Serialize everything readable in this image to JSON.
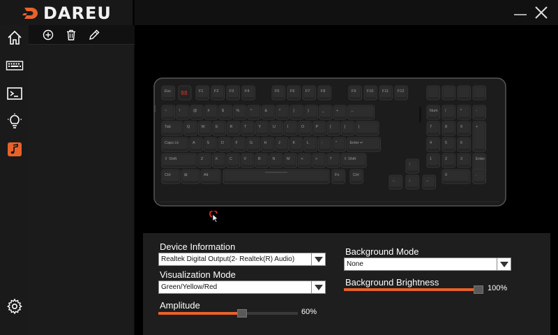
{
  "app": {
    "logo_text": "DAREU",
    "accent": "#e8622a"
  },
  "window": {
    "controls": [
      "minimize-icon",
      "close-icon"
    ]
  },
  "nav": {
    "items": [
      "home-icon",
      "keyboard-icon",
      "terminal-icon",
      "lightbulb-icon",
      "music-icon"
    ],
    "active": "music-icon",
    "bottom": "gear-icon"
  },
  "profile_toolbar": {
    "tools": [
      "add-icon",
      "trash-icon",
      "pencil-icon"
    ]
  },
  "keyboard": {
    "display": "98",
    "row0": [
      "Esc",
      "",
      "F1",
      "F2",
      "F3",
      "F4",
      "F5",
      "F6",
      "F7",
      "F8",
      "F9",
      "F10",
      "F11",
      "F12",
      "",
      "",
      "",
      ""
    ],
    "row1": [
      "~",
      "!",
      "@",
      "#",
      "$",
      "%",
      "^",
      "&",
      "*",
      "(",
      ")",
      "_",
      "+",
      "←",
      "Num",
      "/",
      "*",
      "-"
    ],
    "row2": [
      "Tab",
      "Q",
      "W",
      "E",
      "R",
      "T",
      "Y",
      "U",
      "I",
      "O",
      "P",
      "{",
      "}",
      "|",
      "7",
      "8",
      "9",
      "+"
    ],
    "row3": [
      "Caps Lk",
      "A",
      "S",
      "D",
      "F",
      "G",
      "H",
      "J",
      "K",
      "L",
      ":",
      "\"",
      "Enter ↵",
      "4",
      "5",
      "6"
    ],
    "row4": [
      "⇧ Shift",
      "Z",
      "X",
      "C",
      "V",
      "B",
      "N",
      "M",
      "<",
      ">",
      "?",
      "⇧ Shift",
      "↑",
      "1",
      "2",
      "3",
      "Enter"
    ],
    "row5": [
      "Ctrl",
      "⊞",
      "Alt",
      "",
      "Fn",
      "Ctrl",
      "←",
      "↓",
      "→",
      "0",
      "."
    ]
  },
  "settings": {
    "device_info": {
      "label": "Device Information",
      "value": "Realtek Digital Output(2- Realtek(R) Audio)"
    },
    "visualization_mode": {
      "label": "Visualization Mode",
      "value": "Green/Yellow/Red"
    },
    "amplitude": {
      "label": "Amplitude",
      "value": 60,
      "display": "60%"
    },
    "background_mode": {
      "label": "Background Mode",
      "value": "None"
    },
    "background_brightness": {
      "label": "Background Brightness",
      "value": 100,
      "display": "100%"
    }
  }
}
